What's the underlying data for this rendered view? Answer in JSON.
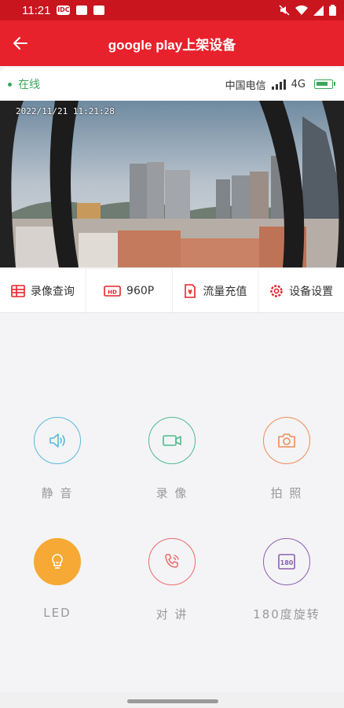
{
  "status_bar": {
    "time": "11:21",
    "notif_badge": "IDC"
  },
  "appbar": {
    "title": "google play上架设备"
  },
  "device_info": {
    "status": "在线",
    "carrier": "中国电信",
    "network": "4G"
  },
  "video": {
    "timestamp": "2022/11/21 11:21:28"
  },
  "toolbar": [
    {
      "label": "录像查询",
      "icon": "record-query-icon"
    },
    {
      "label": "960P",
      "icon": "hd-icon"
    },
    {
      "label": "流量充值",
      "icon": "data-recharge-icon"
    },
    {
      "label": "设备设置",
      "icon": "settings-icon"
    }
  ],
  "controls": [
    {
      "label": "静 音",
      "icon": "speaker-icon",
      "color": "#5bb8e0"
    },
    {
      "label": "录 像",
      "icon": "video-camera-icon",
      "color": "#4dbb8c"
    },
    {
      "label": "拍 照",
      "icon": "camera-icon",
      "color": "#ef8b57"
    },
    {
      "label": "LED",
      "icon": "lightbulb-icon",
      "color": "#f7a935"
    },
    {
      "label": "对 讲",
      "icon": "phone-icon",
      "color": "#ec6a6a"
    },
    {
      "label": "180度旋转",
      "icon": "rotate-180-icon",
      "color": "#8d5fb0"
    }
  ],
  "colors": {
    "statusbar": "#c9151e",
    "appbar": "#e8222c",
    "online": "#3aa85a",
    "accent": "#e8222c"
  }
}
